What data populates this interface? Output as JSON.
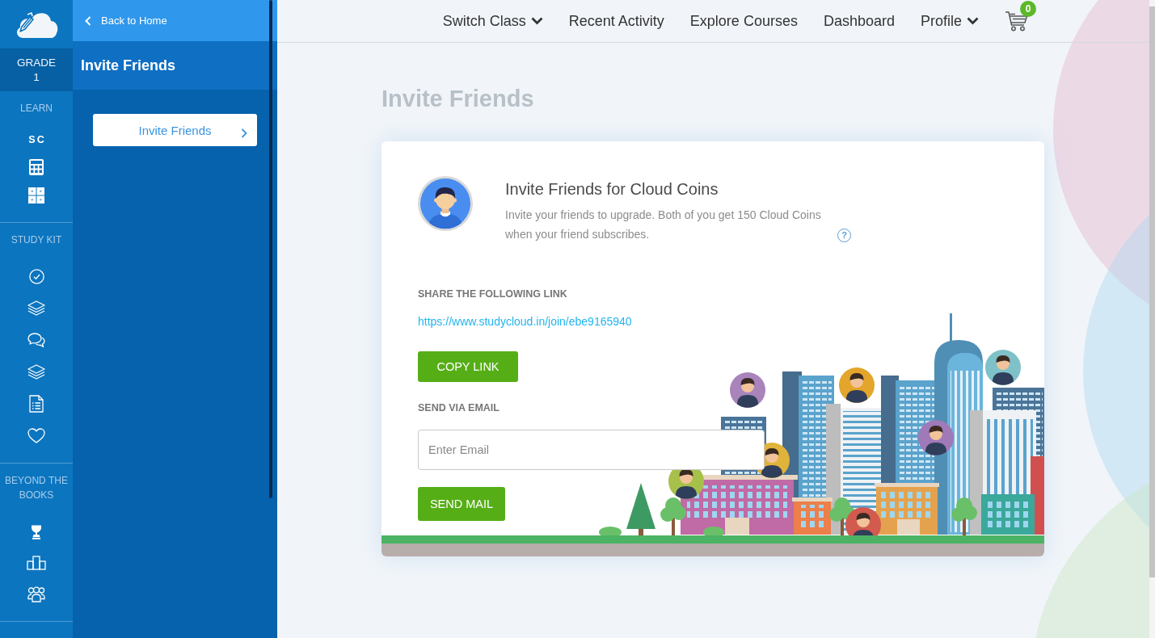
{
  "rail": {
    "grade": {
      "label": "GRADE",
      "value": "1"
    },
    "sections": [
      {
        "title": "LEARN",
        "subject": "SC"
      },
      {
        "title": "STUDY KIT"
      },
      {
        "title": "BEYOND THE BOOKS"
      }
    ]
  },
  "panel": {
    "back_link": "Back to Home",
    "title": "Invite Friends",
    "items": [
      {
        "label": "Invite Friends",
        "selected": true
      }
    ]
  },
  "nav": {
    "items": [
      {
        "label": "Switch Class",
        "dropdown": true
      },
      {
        "label": "Recent Activity",
        "dropdown": false
      },
      {
        "label": "Explore Courses",
        "dropdown": false
      },
      {
        "label": "Dashboard",
        "dropdown": false
      },
      {
        "label": "Profile",
        "dropdown": true
      }
    ],
    "cart_count": "0"
  },
  "page_title": "Invite Friends",
  "invite_card": {
    "title": "Invite Friends for Cloud Coins",
    "description": "Invite your friends to upgrade. Both of you get 150 Cloud Coins when your friend subscribes.",
    "help_mark": "?",
    "share_heading": "SHARE THE FOLLOWING LINK",
    "share_link": "https://www.studycloud.in/join/ebe9165940",
    "copy_button": "COPY LINK",
    "email_heading": "SEND VIA EMAIL",
    "email_field": {
      "placeholder": "Enter Email"
    },
    "send_button": "SEND MAIL"
  }
}
